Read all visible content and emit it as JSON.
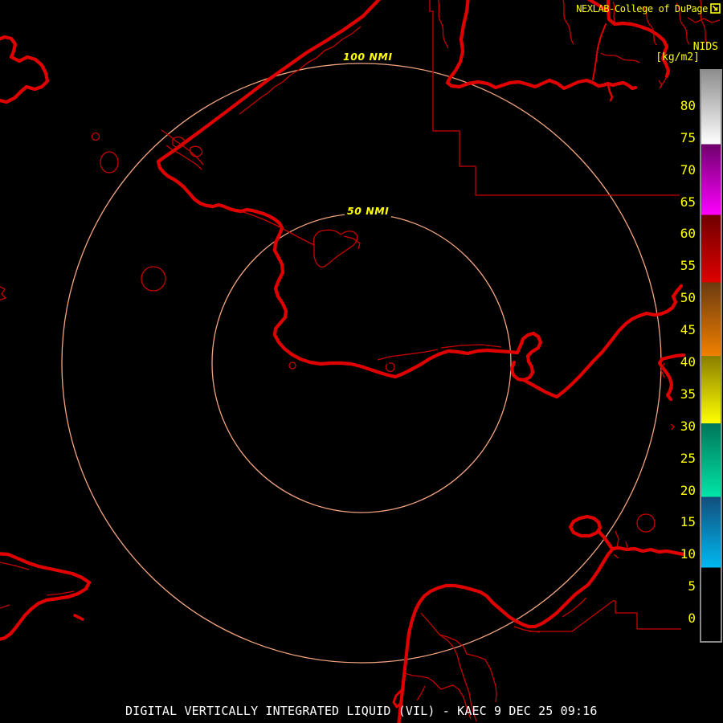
{
  "header": {
    "credit": "NEXLAB-College of DuPage",
    "flag_icon": "cod-weathervane-icon",
    "product_code": "NIDS",
    "unit": "[kg/m2]"
  },
  "rings": [
    {
      "label": "100 NMI",
      "radius_nmi": 100
    },
    {
      "label": "50 NMI",
      "radius_nmi": 50
    }
  ],
  "colorbar": {
    "tick_labels": [
      "80",
      "75",
      "70",
      "65",
      "60",
      "55",
      "50",
      "45",
      "40",
      "35",
      "30",
      "25",
      "20",
      "15",
      "10",
      "5",
      "0"
    ],
    "value_top": 85.5,
    "value_bottom": -3.5,
    "segments": [
      {
        "from": 85.5,
        "to": 74,
        "c1": "#8F8F8F",
        "c2": "#FFFFFF"
      },
      {
        "from": 74,
        "to": 63,
        "c1": "#6E006C",
        "c2": "#FF00FF"
      },
      {
        "from": 63,
        "to": 52.5,
        "c1": "#6E0000",
        "c2": "#E00000"
      },
      {
        "from": 52.5,
        "to": 41,
        "c1": "#6B3A10",
        "c2": "#F08000"
      },
      {
        "from": 41,
        "to": 30.5,
        "c1": "#8A7D00",
        "c2": "#FFFF00"
      },
      {
        "from": 30.5,
        "to": 19,
        "c1": "#007458",
        "c2": "#00E6A8"
      },
      {
        "from": 19,
        "to": 8,
        "c1": "#124E7C",
        "c2": "#00B8F0"
      },
      {
        "from": 8,
        "to": -3.5,
        "c1": "#000000",
        "c2": "#000000"
      }
    ],
    "border_color": "#8A8A8A",
    "label_color": "#FFFF00"
  },
  "footer": {
    "title": "DIGITAL VERTICALLY INTEGRATED LIQUID (VIL) - KAEC 9 DEC 25 09:16",
    "product_name": "DIGITAL VERTICALLY INTEGRATED LIQUID (VIL)",
    "station_id": "KAEC",
    "datetime": "9 DEC 25 09:16"
  },
  "colors": {
    "background": "#000000",
    "map_line_thick": "#E00000",
    "map_line_thin": "#C80000",
    "range_ring": "#F2A47F",
    "label_yellow": "#FFFF00",
    "title_white": "#FFFFFF"
  }
}
